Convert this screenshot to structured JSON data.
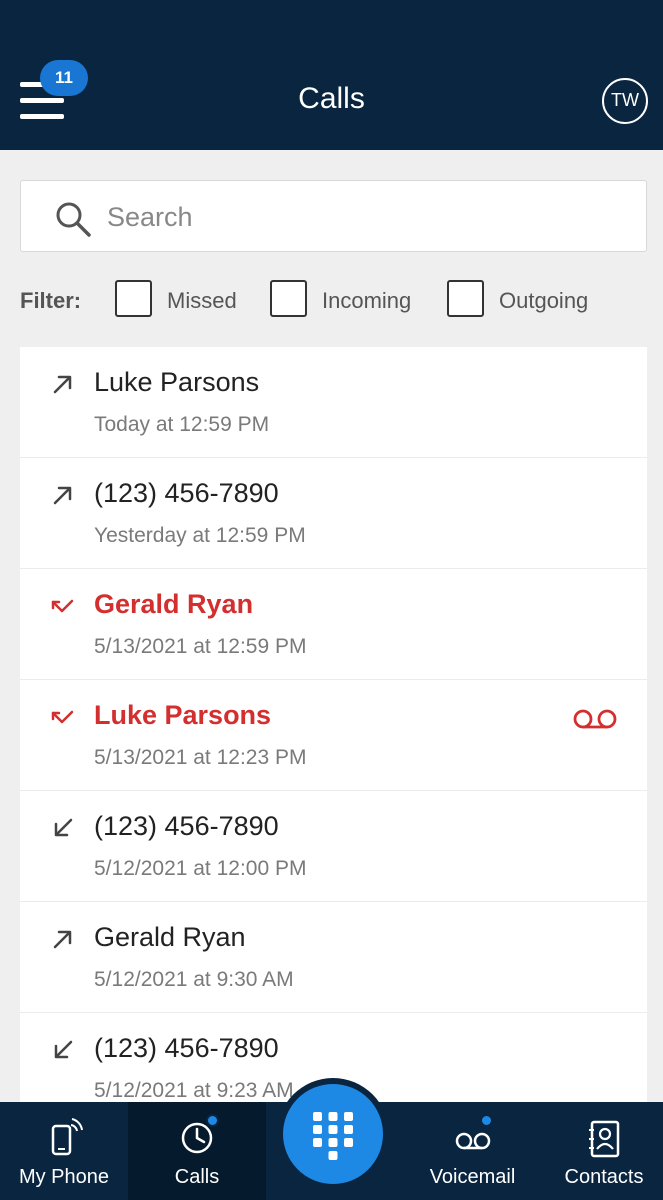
{
  "header": {
    "title": "Calls",
    "menu_badge": "11",
    "avatar_initials": "TW"
  },
  "search": {
    "placeholder": "Search",
    "value": ""
  },
  "filter": {
    "label": "Filter:",
    "options": [
      {
        "label": "Missed",
        "checked": false
      },
      {
        "label": "Incoming",
        "checked": false
      },
      {
        "label": "Outgoing",
        "checked": false
      }
    ]
  },
  "calls": [
    {
      "name": "Luke Parsons",
      "time": "Today at 12:59 PM",
      "direction": "outgoing",
      "icon": "outgoing-call-icon",
      "voicemail": false
    },
    {
      "name": "(123) 456-7890",
      "time": "Yesterday at 12:59 PM",
      "direction": "outgoing",
      "icon": "outgoing-call-icon",
      "voicemail": false
    },
    {
      "name": "Gerald Ryan",
      "time": "5/13/2021 at 12:59 PM",
      "direction": "missed",
      "icon": "missed-call-icon",
      "voicemail": false
    },
    {
      "name": "Luke Parsons",
      "time": "5/13/2021 at 12:23 PM",
      "direction": "missed",
      "icon": "missed-call-icon",
      "voicemail": true
    },
    {
      "name": "(123) 456-7890",
      "time": "5/12/2021 at 12:00 PM",
      "direction": "incoming",
      "icon": "incoming-call-icon",
      "voicemail": false
    },
    {
      "name": "Gerald Ryan",
      "time": "5/12/2021 at 9:30 AM",
      "direction": "outgoing",
      "icon": "outgoing-call-icon",
      "voicemail": false
    },
    {
      "name": "(123) 456-7890",
      "time": "5/12/2021 at 9:23 AM",
      "direction": "incoming",
      "icon": "incoming-call-icon",
      "voicemail": false
    }
  ],
  "bottom_nav": {
    "items": [
      {
        "label": "My Phone",
        "icon": "phone-icon",
        "active": false,
        "dot": false
      },
      {
        "label": "Calls",
        "icon": "clock-icon",
        "active": true,
        "dot": true
      },
      {
        "label": "Voicemail",
        "icon": "voicemail-icon",
        "active": false,
        "dot": true
      },
      {
        "label": "Contacts",
        "icon": "contacts-icon",
        "active": false,
        "dot": false
      }
    ],
    "dialpad_icon": "dialpad-icon"
  },
  "colors": {
    "header_bg": "#0a2540",
    "accent": "#1e88e5",
    "missed": "#d32f2f",
    "text": "#222222",
    "muted": "#7a7a7a"
  }
}
